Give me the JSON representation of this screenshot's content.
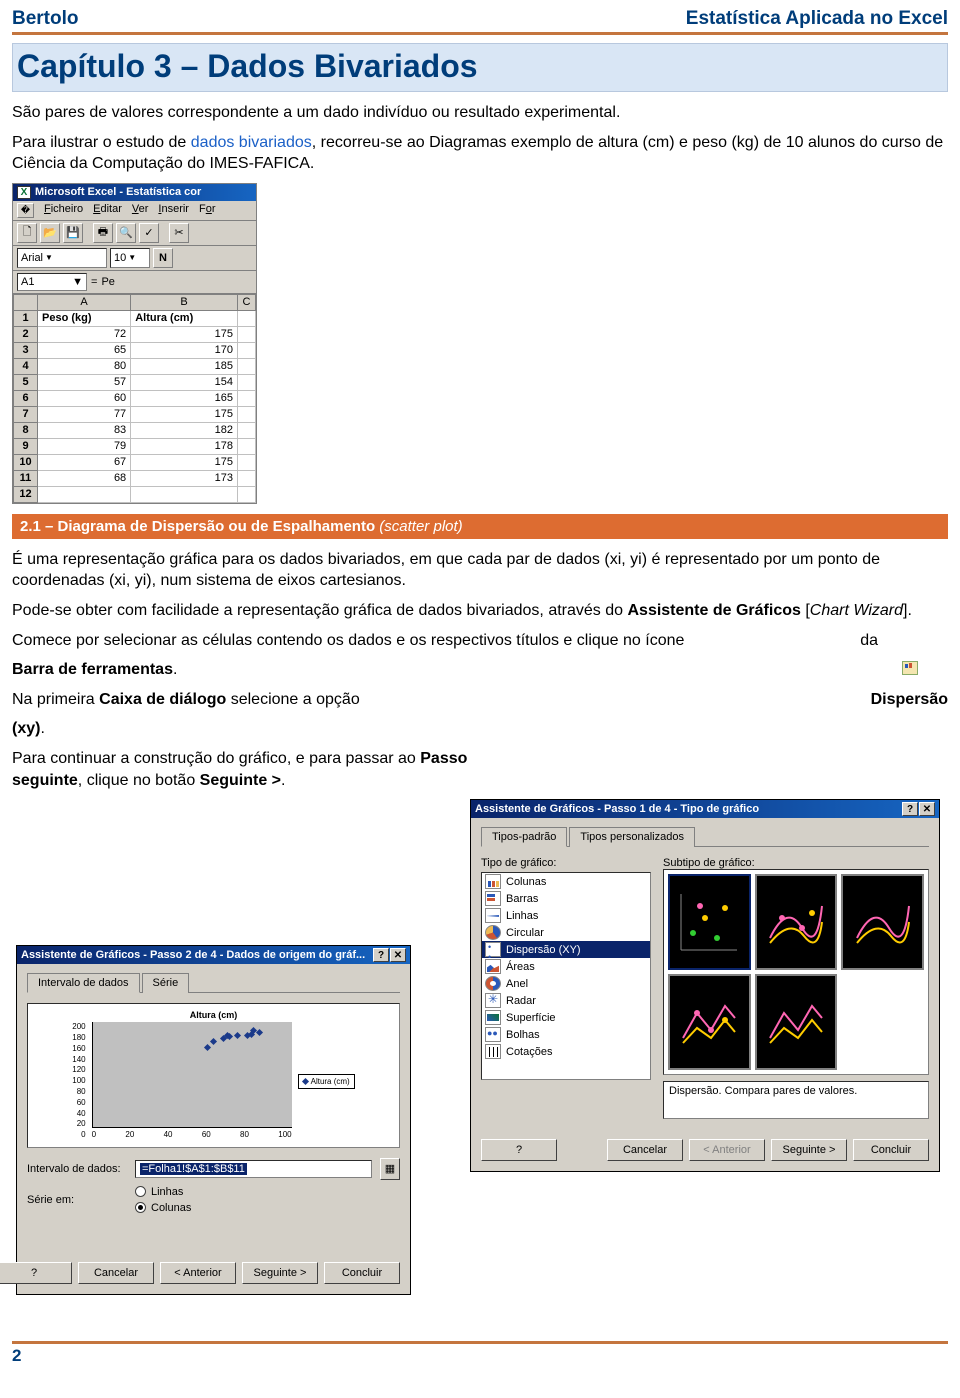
{
  "header": {
    "left": "Bertolo",
    "right": "Estatística Aplicada no Excel"
  },
  "chapter": {
    "title": "Capítulo 3 – Dados Bivariados"
  },
  "intro": {
    "p1": "São pares de valores correspondente a um dado indivíduo ou resultado experimental.",
    "p2_a": "Para ilustrar o estudo de ",
    "p2_link": "dados bivariados",
    "p2_b": ", recorreu-se ao Diagramas exemplo  de altura (cm) e peso (kg) de 10 alunos do curso de Ciência da Computação do IMES-FAFICA."
  },
  "excel": {
    "title": "Microsoft Excel - Estatística cor",
    "menus": {
      "m1": "Ficheiro",
      "m2": "Editar",
      "m3": "Ver",
      "m4": "Inserir",
      "m5": "For"
    },
    "font": "Arial",
    "size": "10",
    "name_box": "A1",
    "formula_prefix": "=",
    "formula_val": "Pe",
    "cols": {
      "A": "A",
      "B": "B",
      "C": "C"
    },
    "h1": "Peso (kg)",
    "h2": "Altura (cm)",
    "rows": [
      {
        "n": "1"
      },
      {
        "n": "2",
        "a": "72",
        "b": "175"
      },
      {
        "n": "3",
        "a": "65",
        "b": "170"
      },
      {
        "n": "4",
        "a": "80",
        "b": "185"
      },
      {
        "n": "5",
        "a": "57",
        "b": "154"
      },
      {
        "n": "6",
        "a": "60",
        "b": "165"
      },
      {
        "n": "7",
        "a": "77",
        "b": "175"
      },
      {
        "n": "8",
        "a": "83",
        "b": "182"
      },
      {
        "n": "9",
        "a": "79",
        "b": "178"
      },
      {
        "n": "10",
        "a": "67",
        "b": "175"
      },
      {
        "n": "11",
        "a": "68",
        "b": "173"
      },
      {
        "n": "12"
      }
    ]
  },
  "section": {
    "num_title": "2.1 – Diagrama de Dispersão ou de Espalhamento ",
    "ital": "(scatter plot)"
  },
  "body": {
    "p1": "É uma representação gráfica para os dados bivariados, em que cada par de dados (xi, yi) é representado por um ponto de  coordenadas (xi, yi), num sistema de eixos cartesianos.",
    "p2_a": "Pode-se obter com facilidade a representação gráfica de dados bivariados, através do ",
    "p2_b": "Assistente de Gráficos",
    "p2_c": " [",
    "p2_d": "Chart Wizard",
    "p2_e": "].",
    "p3_a": "Comece por selecionar as células contendo os dados e os respectivos títulos e clique no ícone",
    "p3_b": "da",
    "p4": "Barra de ferramentas",
    "p4_dot": ".",
    "p5_a": "Na primeira ",
    "p5_b": "Caixa de diálogo",
    "p5_c": " selecione a opção",
    "p5_right": "Dispersão",
    "p6": "(xy)",
    "p6_dot": ".",
    "p7_a": "Para continuar a construção do gráfico, e para passar ao",
    "p7_b": "Passo seguinte",
    "p7_c": ", clique no botão ",
    "p7_d": "Seguinte >",
    "p7_e": "."
  },
  "wizard1": {
    "title": "Assistente de Gráficos - Passo 1 de 4 - Tipo de gráfico",
    "tab1": "Tipos-padrão",
    "tab2": "Tipos personalizados",
    "lbl_type": "Tipo de gráfico:",
    "lbl_sub": "Subtipo de gráfico:",
    "types": {
      "t1": "Colunas",
      "t2": "Barras",
      "t3": "Linhas",
      "t4": "Circular",
      "t5": "Dispersão (XY)",
      "t6": "Áreas",
      "t7": "Anel",
      "t8": "Radar",
      "t9": "Superfície",
      "t10": "Bolhas",
      "t11": "Cotações"
    },
    "desc": "Dispersão. Compara pares de valores.",
    "btn_help": "?",
    "btn_cancel": "Cancelar",
    "btn_back": "< Anterior",
    "btn_next": "Seguinte >",
    "btn_finish": "Concluir"
  },
  "wizard2": {
    "title": "Assistente de Gráficos - Passo 2 de 4 - Dados de origem do gráf...",
    "tab1": "Intervalo de dados",
    "tab2": "Série",
    "preview_title": "Altura (cm)",
    "y_ticks": [
      "200",
      "180",
      "160",
      "140",
      "120",
      "100",
      "80",
      "60",
      "40",
      "20",
      "0"
    ],
    "x_ticks": [
      "0",
      "20",
      "40",
      "60",
      "80",
      "100"
    ],
    "legend": "Altura (cm)",
    "lbl_range": "Intervalo de dados:",
    "range_val": "=Folha1!$A$1:$B$11",
    "lbl_series": "Série em:",
    "radio_rows": "Linhas",
    "radio_cols": "Colunas",
    "btn_help": "?",
    "btn_cancel": "Cancelar",
    "btn_back": "< Anterior",
    "btn_next": "Seguinte >",
    "btn_finish": "Concluir"
  },
  "page_num": "2",
  "chart_data": {
    "type": "scatter",
    "title": "Altura (cm)",
    "xlabel": "",
    "ylabel": "",
    "xlim": [
      0,
      100
    ],
    "ylim": [
      0,
      200
    ],
    "series": [
      {
        "name": "Altura (cm)",
        "x": [
          72,
          65,
          80,
          57,
          60,
          77,
          83,
          79,
          67,
          68
        ],
        "y": [
          175,
          170,
          185,
          154,
          165,
          175,
          182,
          178,
          175,
          173
        ]
      }
    ]
  }
}
